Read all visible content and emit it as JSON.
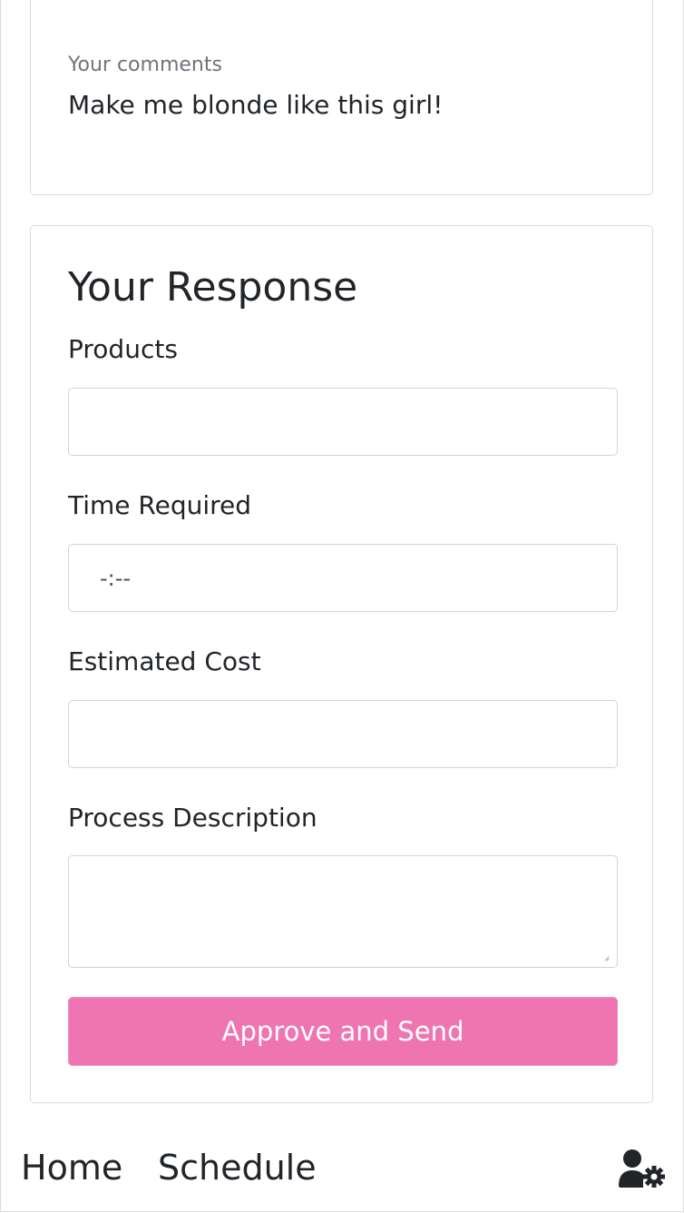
{
  "comments": {
    "label": "Your comments",
    "text": "Make me blonde like this girl!"
  },
  "response": {
    "title": "Your Response",
    "fields": {
      "products": {
        "label": "Products",
        "value": ""
      },
      "time_required": {
        "label": "Time Required",
        "value": "-:--"
      },
      "estimated_cost": {
        "label": "Estimated Cost",
        "value": ""
      },
      "process_description": {
        "label": "Process Description",
        "value": ""
      }
    },
    "submit_label": "Approve and Send"
  },
  "nav": {
    "home_label": "Home",
    "schedule_label": "Schedule",
    "settings_icon": "user-settings-icon"
  },
  "colors": {
    "accent": "#ef75b2",
    "text": "#212529",
    "muted": "#6c757d",
    "border": "#dcdcdc"
  }
}
